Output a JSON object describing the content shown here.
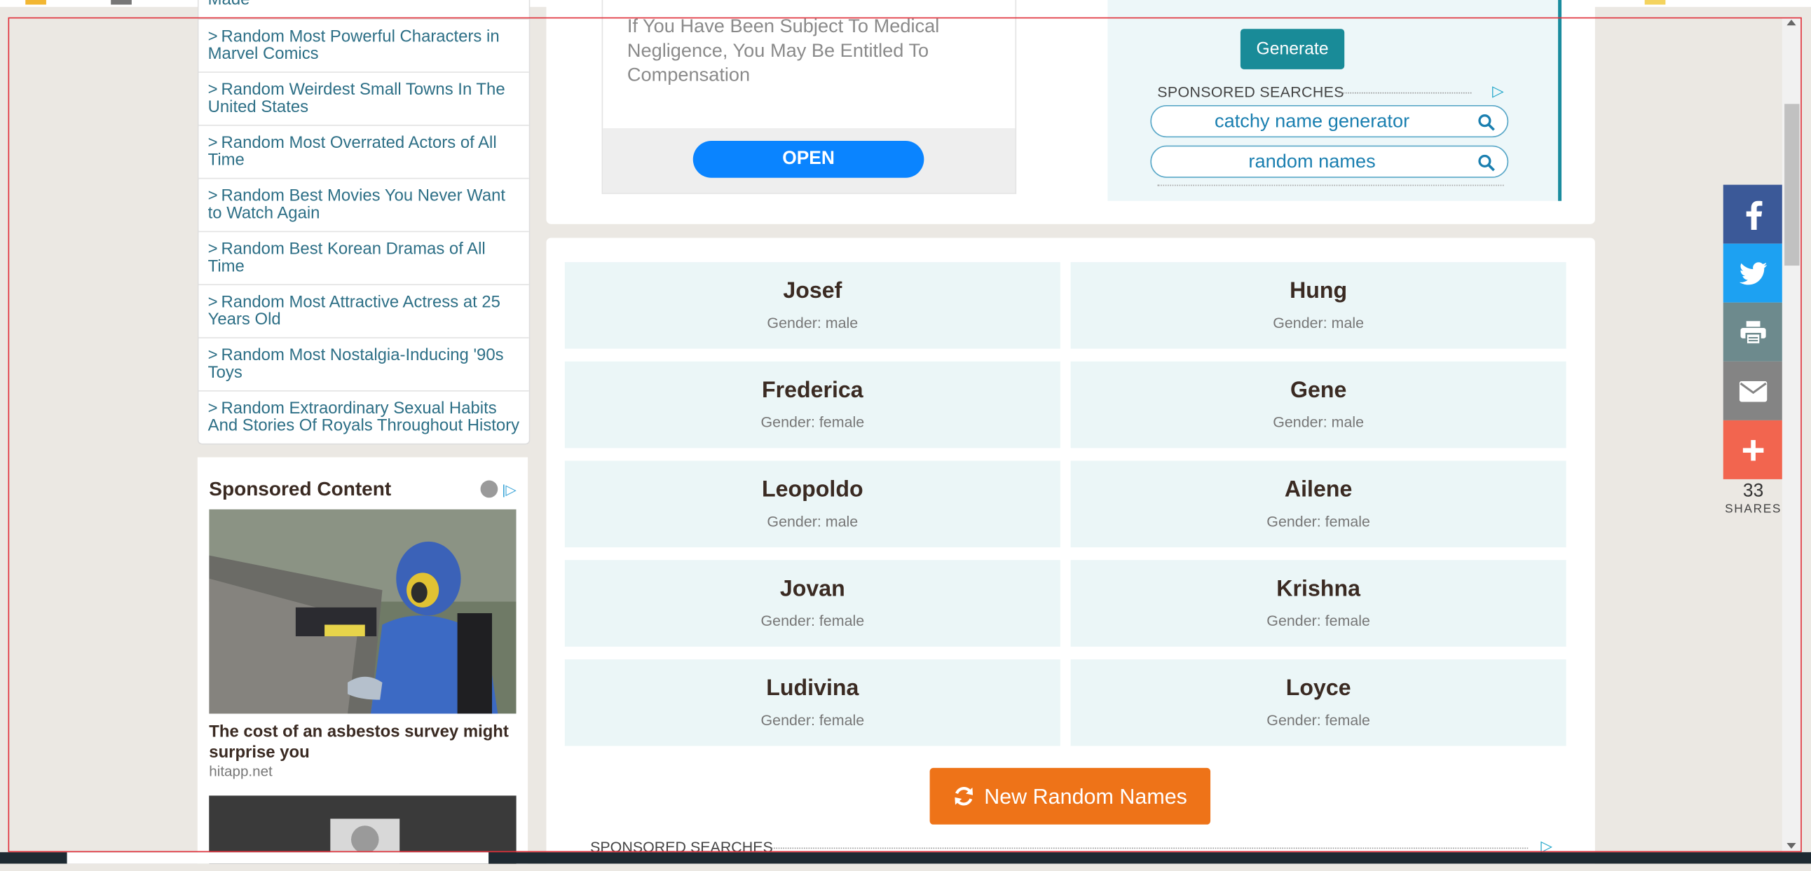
{
  "sidebar": {
    "links": [
      {
        "label": "Made"
      },
      {
        "label": "Random Most Powerful Characters in Marvel Comics"
      },
      {
        "label": "Random Weirdest Small Towns In The United States"
      },
      {
        "label": "Random Most Overrated Actors of All Time"
      },
      {
        "label": "Random Best Movies You Never Want to Watch Again"
      },
      {
        "label": "Random Best Korean Dramas of All Time"
      },
      {
        "label": "Random Most Attractive Actress at 25 Years Old"
      },
      {
        "label": "Random Most Nostalgia-Inducing '90s Toys"
      },
      {
        "label": "Random Extraordinary Sexual Habits And Stories Of Royals Throughout History"
      }
    ],
    "chevron": ">",
    "sponsored": {
      "title": "Sponsored Content",
      "headline": "The cost of an asbestos survey might surprise you",
      "source": "hitapp.net"
    }
  },
  "ad": {
    "text": "If You Have Been Subject To Medical Negligence, You May Be Entitled To Compensation",
    "open_label": "OPEN"
  },
  "generator": {
    "generate_label": "Generate",
    "sponsored_searches_label": "SPONSORED SEARCHES",
    "searches": [
      "catchy name generator",
      "random names"
    ]
  },
  "names": [
    {
      "name": "Josef",
      "gender": "Gender: male"
    },
    {
      "name": "Hung",
      "gender": "Gender: male"
    },
    {
      "name": "Frederica",
      "gender": "Gender: female"
    },
    {
      "name": "Gene",
      "gender": "Gender: male"
    },
    {
      "name": "Leopoldo",
      "gender": "Gender: male"
    },
    {
      "name": "Ailene",
      "gender": "Gender: female"
    },
    {
      "name": "Jovan",
      "gender": "Gender: female"
    },
    {
      "name": "Krishna",
      "gender": "Gender: female"
    },
    {
      "name": "Ludivina",
      "gender": "Gender: female"
    },
    {
      "name": "Loyce",
      "gender": "Gender: female"
    }
  ],
  "new_names_label": "New Random Names",
  "bottom_sponsored_label": "SPONSORED SEARCHES",
  "share": {
    "count": "33",
    "label": "SHARES",
    "icons": [
      "facebook-icon",
      "twitter-icon",
      "print-icon",
      "email-icon",
      "plus-icon"
    ]
  },
  "colors": {
    "accent_teal": "#198b98",
    "button_orange": "#ee7318",
    "open_blue": "#0a84ff",
    "facebook": "#3b5998",
    "twitter": "#1da1f2"
  }
}
